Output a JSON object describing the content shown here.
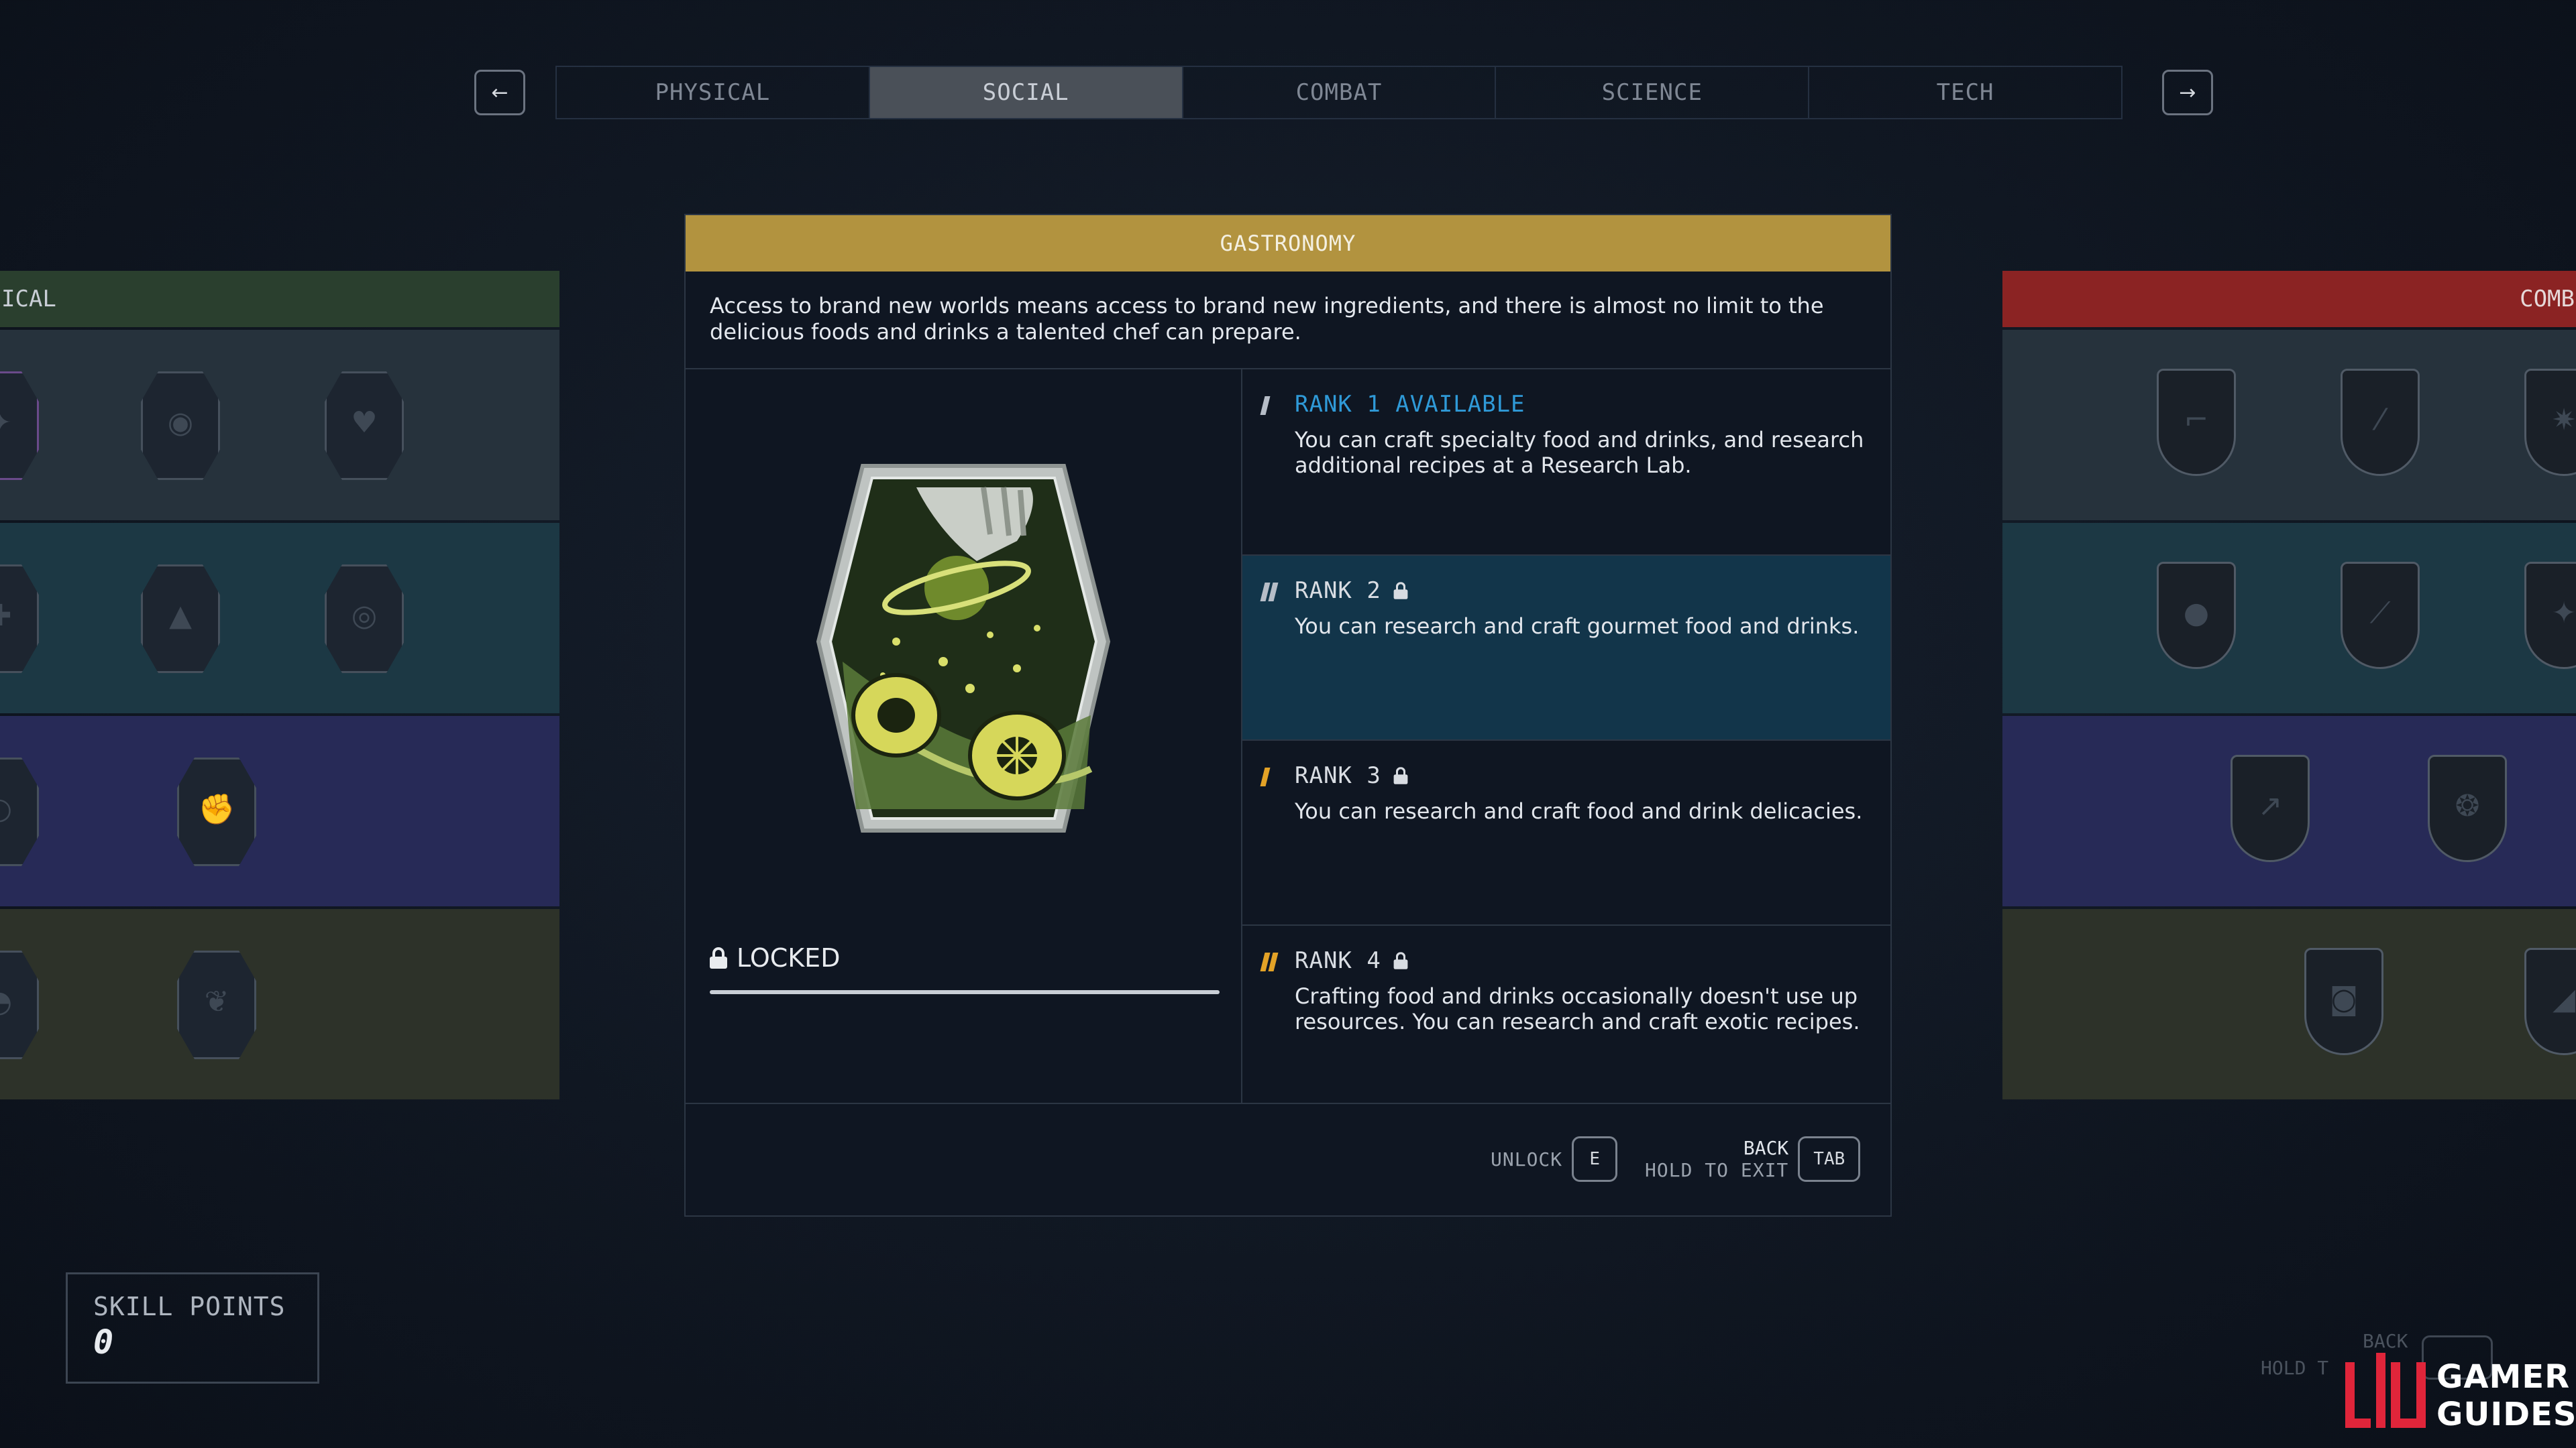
{
  "tabs": {
    "prev_arrow": "←",
    "next_arrow": "→",
    "items": [
      {
        "label": "PHYSICAL",
        "active": false
      },
      {
        "label": "SOCIAL",
        "active": true
      },
      {
        "label": "COMBAT",
        "active": false
      },
      {
        "label": "SCIENCE",
        "active": false
      },
      {
        "label": "TECH",
        "active": false
      }
    ]
  },
  "left_panel": {
    "header": "ICAL",
    "color": "#2a3f2e"
  },
  "right_panel": {
    "header": "COMB",
    "color": "#8b2323"
  },
  "skill": {
    "title": "GASTRONOMY",
    "title_color": "#b2933f",
    "description": "Access to brand new worlds means access to brand new ingredients, and there is almost no limit to the delicious foods and drinks a talented chef can prepare.",
    "status": "LOCKED",
    "ranks": [
      {
        "title": "RANK 1 AVAILABLE",
        "locked": false,
        "available": true,
        "description": "You can craft specialty food and drinks, and research additional recipes at a Research Lab."
      },
      {
        "title": "RANK 2",
        "locked": true,
        "available": false,
        "description": "You can research and craft gourmet food and drinks."
      },
      {
        "title": "RANK 3",
        "locked": true,
        "available": false,
        "description": "You can research and craft food and drink delicacies."
      },
      {
        "title": "RANK 4",
        "locked": true,
        "available": false,
        "description": "Crafting food and drinks occasionally doesn't use up resources. You can research and craft exotic recipes."
      }
    ]
  },
  "footer": {
    "unlock_label": "UNLOCK",
    "unlock_key": "E",
    "back_label": "BACK",
    "hold_label": "HOLD TO EXIT",
    "back_key": "TAB"
  },
  "skill_points": {
    "label": "SKILL POINTS",
    "value": "0"
  },
  "faded_hint": {
    "back": "BACK",
    "hold": "HOLD T"
  },
  "watermark": {
    "line1": "GAMER",
    "line2": "GUIDES"
  },
  "colors": {
    "accent_blue": "#2f9ad8",
    "rank_orange": "#e3a227",
    "highlight_row": "#12354a"
  },
  "icons": [
    "arrow-left-icon",
    "arrow-right-icon",
    "lock-icon",
    "gastronomy-badge-icon"
  ]
}
